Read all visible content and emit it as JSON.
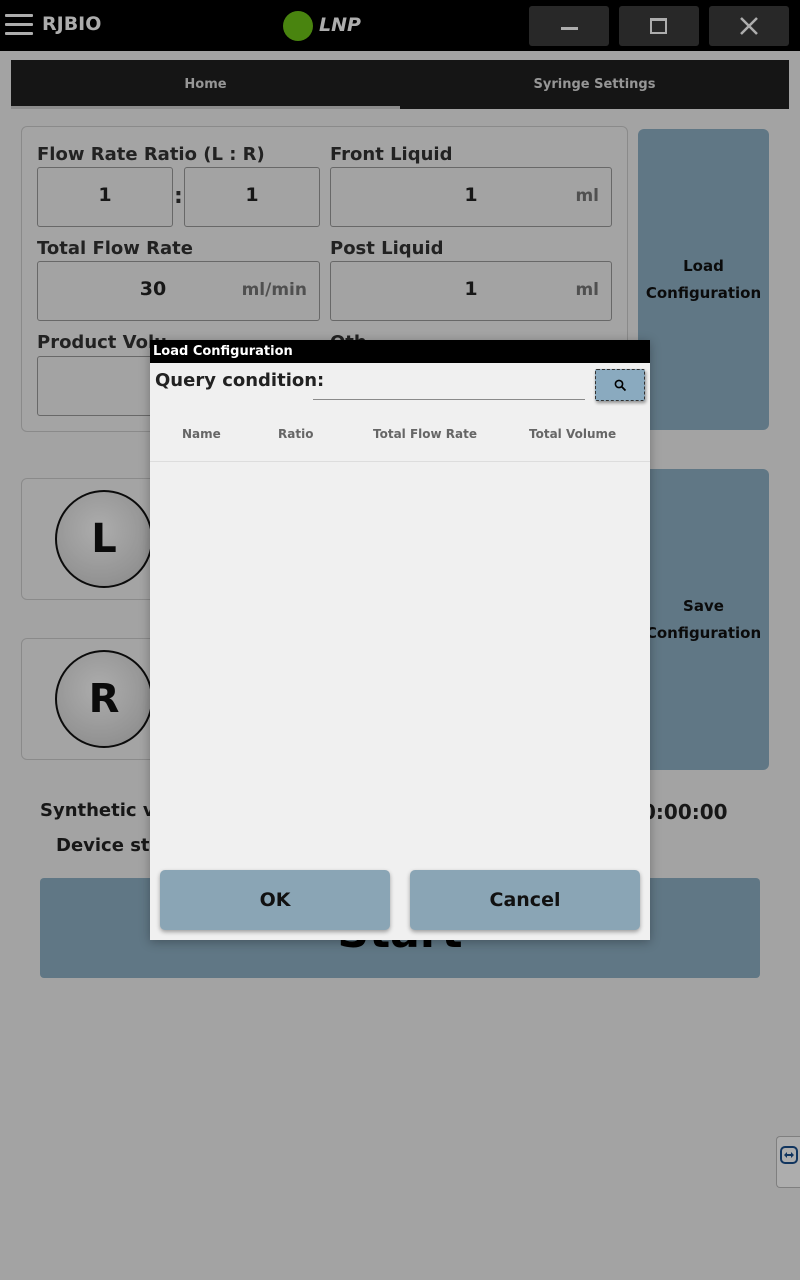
{
  "titlebar": {
    "brand": "RJBIO",
    "app_name": "LNP",
    "status_color": "#6cc317",
    "icons": [
      "hamburger-menu-icon",
      "minimize-icon",
      "maximize-icon",
      "close-icon"
    ]
  },
  "tabs": [
    {
      "label": "Home",
      "active": true
    },
    {
      "label": "Syringe Settings",
      "active": false
    }
  ],
  "form": {
    "flow_rate_ratio": {
      "label": "Flow Rate Ratio (L : R)",
      "left": "1",
      "separator": ":",
      "right": "1"
    },
    "front_liquid": {
      "label": "Front Liquid",
      "value": "1",
      "unit": "ml"
    },
    "total_flow_rate": {
      "label": "Total Flow Rate",
      "value": "30",
      "unit": "ml/min"
    },
    "post_liquid": {
      "label": "Post Liquid",
      "value": "1",
      "unit": "ml"
    },
    "product_volume_label": "Product Volu",
    "other_label": "Oth",
    "load_config": [
      "Load",
      "Configuration"
    ],
    "save_config": [
      "Save",
      "Configuration"
    ],
    "left_syringe": "L",
    "right_syringe": "R",
    "synthetic_label": "Synthetic vo",
    "timer": "0:00:00",
    "device_label": "Device sta",
    "start_label": "Start"
  },
  "dialog": {
    "title": "Load Configuration",
    "query_label": "Query condition:",
    "query_value": "",
    "columns": [
      "Name",
      "Ratio",
      "Total Flow Rate",
      "Total Volume"
    ],
    "rows": [],
    "ok_label": "OK",
    "cancel_label": "Cancel"
  },
  "colors": {
    "accent": "#8eb0c4",
    "titlebar": "#000000"
  }
}
